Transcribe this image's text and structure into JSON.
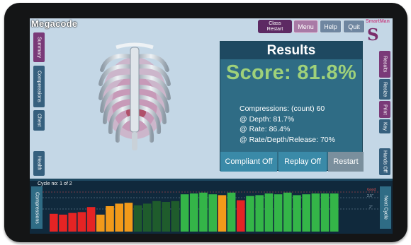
{
  "app": {
    "title": "Megacode"
  },
  "topbar": {
    "class_restart_line1": "Class",
    "class_restart_line2": "Restart",
    "menu": "Menu",
    "help": "Help",
    "quit": "Quit"
  },
  "logo": {
    "text": "SmartMan",
    "glyph": "S"
  },
  "left_tabs": [
    "Summary",
    "Compressions",
    "Chest",
    "Health"
  ],
  "right_tabs": [
    "Results",
    "Resize",
    "Print",
    "Key",
    "Hands Off"
  ],
  "results": {
    "header": "Results",
    "score": "Score: 81.8%",
    "stats": [
      "Compressions: (count) 60",
      "@ Depth: 81.7%",
      "@ Rate: 86.4%",
      "@ Rate/Depth/Release: 70%"
    ],
    "buttons": {
      "compliant": "Compliant Off",
      "replay": "Replay Off",
      "restart": "Restart"
    }
  },
  "cycle": {
    "label": "Cycle no: 1 of 2",
    "compressions_tab": "Compressions",
    "next_tab": "Next Cycle",
    "scale_labels": [
      "Good",
      "2.5\"",
      "2\""
    ]
  },
  "colors": {
    "red": "#e52424",
    "orange": "#f29a1a",
    "dark_green": "#1f5c2c",
    "green": "#34b548"
  },
  "chart_data": {
    "type": "bar",
    "values": [
      0.42,
      0.4,
      0.44,
      0.46,
      0.58,
      0.4,
      0.6,
      0.66,
      0.68,
      0.62,
      0.66,
      0.72,
      0.7,
      0.72,
      0.88,
      0.9,
      0.92,
      0.88,
      0.86,
      0.92,
      0.74,
      0.84,
      0.86,
      0.9,
      0.88,
      0.92,
      0.86,
      0.88,
      0.9,
      0.9,
      0.9
    ],
    "bar_colors": [
      "red",
      "red",
      "red",
      "red",
      "red",
      "orange",
      "orange",
      "orange",
      "orange",
      "dark_green",
      "dark_green",
      "dark_green",
      "dark_green",
      "dark_green",
      "green",
      "green",
      "green",
      "green",
      "orange",
      "green",
      "red",
      "green",
      "green",
      "green",
      "green",
      "green",
      "green",
      "green",
      "green",
      "green",
      "green"
    ]
  }
}
